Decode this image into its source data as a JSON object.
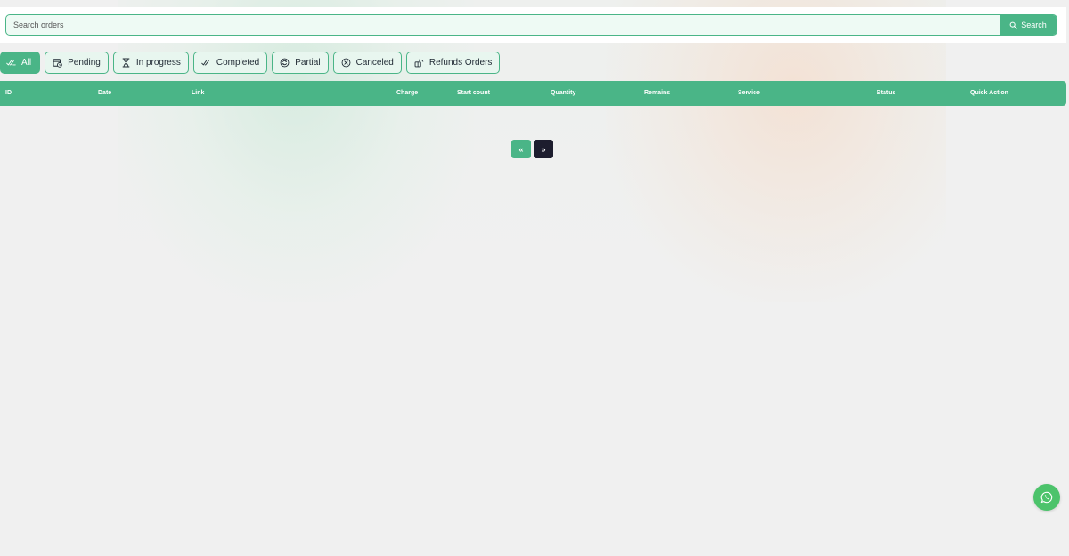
{
  "search": {
    "placeholder": "Search orders",
    "value": "",
    "button_label": "Search",
    "button_icon": "search-icon"
  },
  "filters": [
    {
      "label": "All",
      "icon": "double-check-icon",
      "active": true
    },
    {
      "label": "Pending",
      "icon": "calendar-clock-icon",
      "active": false
    },
    {
      "label": "In progress",
      "icon": "hourglass-icon",
      "active": false
    },
    {
      "label": "Completed",
      "icon": "double-check-icon",
      "active": false
    },
    {
      "label": "Partial",
      "icon": "circle-refresh-icon",
      "active": false
    },
    {
      "label": "Canceled",
      "icon": "circle-x-icon",
      "active": false
    },
    {
      "label": "Refunds Orders",
      "icon": "refund-icon",
      "active": false
    }
  ],
  "table": {
    "columns": [
      "ID",
      "Date",
      "Link",
      "Charge",
      "Start count",
      "Quantity",
      "Remains",
      "Service",
      "Status",
      "Quick Action"
    ],
    "rows": []
  },
  "pagination": {
    "prev_label": "«",
    "next_label": "»"
  },
  "colors": {
    "accent": "#4ab587",
    "dark": "#1d1d2e",
    "whatsapp": "#4cc36b",
    "background": "#f0f0f0"
  }
}
